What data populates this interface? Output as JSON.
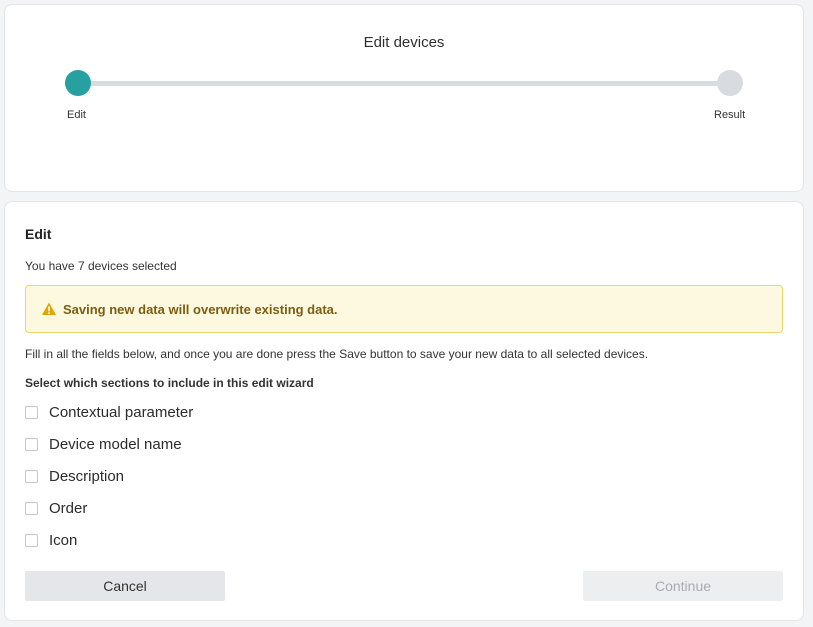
{
  "wizard": {
    "title": "Edit devices",
    "steps": [
      {
        "label": "Edit",
        "state": "active"
      },
      {
        "label": "Result",
        "state": "pending"
      }
    ],
    "progress_fraction": 0.0
  },
  "edit": {
    "heading": "Edit",
    "selected_text": "You have 7 devices selected",
    "warning": {
      "icon": "warning-triangle-icon",
      "text": "Saving new data will overwrite existing data."
    },
    "instructions": "Fill in all the fields below, and once you are done press the Save button to save your new data to all selected devices.",
    "sections_heading": "Select which sections to include in this edit wizard",
    "sections": [
      {
        "label": "Contextual parameter",
        "checked": false
      },
      {
        "label": "Device model name",
        "checked": false
      },
      {
        "label": "Description",
        "checked": false
      },
      {
        "label": "Order",
        "checked": false
      },
      {
        "label": "Icon",
        "checked": false
      }
    ]
  },
  "actions": {
    "cancel_label": "Cancel",
    "continue_label": "Continue",
    "continue_enabled": false
  },
  "colors": {
    "accent": "#26a0a0",
    "inactive_step": "#d8dbe0",
    "warning_bg": "#fdf9e1",
    "warning_border": "#ecd56c",
    "warning_text": "#7a5d13",
    "warning_icon": "#e2a400"
  }
}
